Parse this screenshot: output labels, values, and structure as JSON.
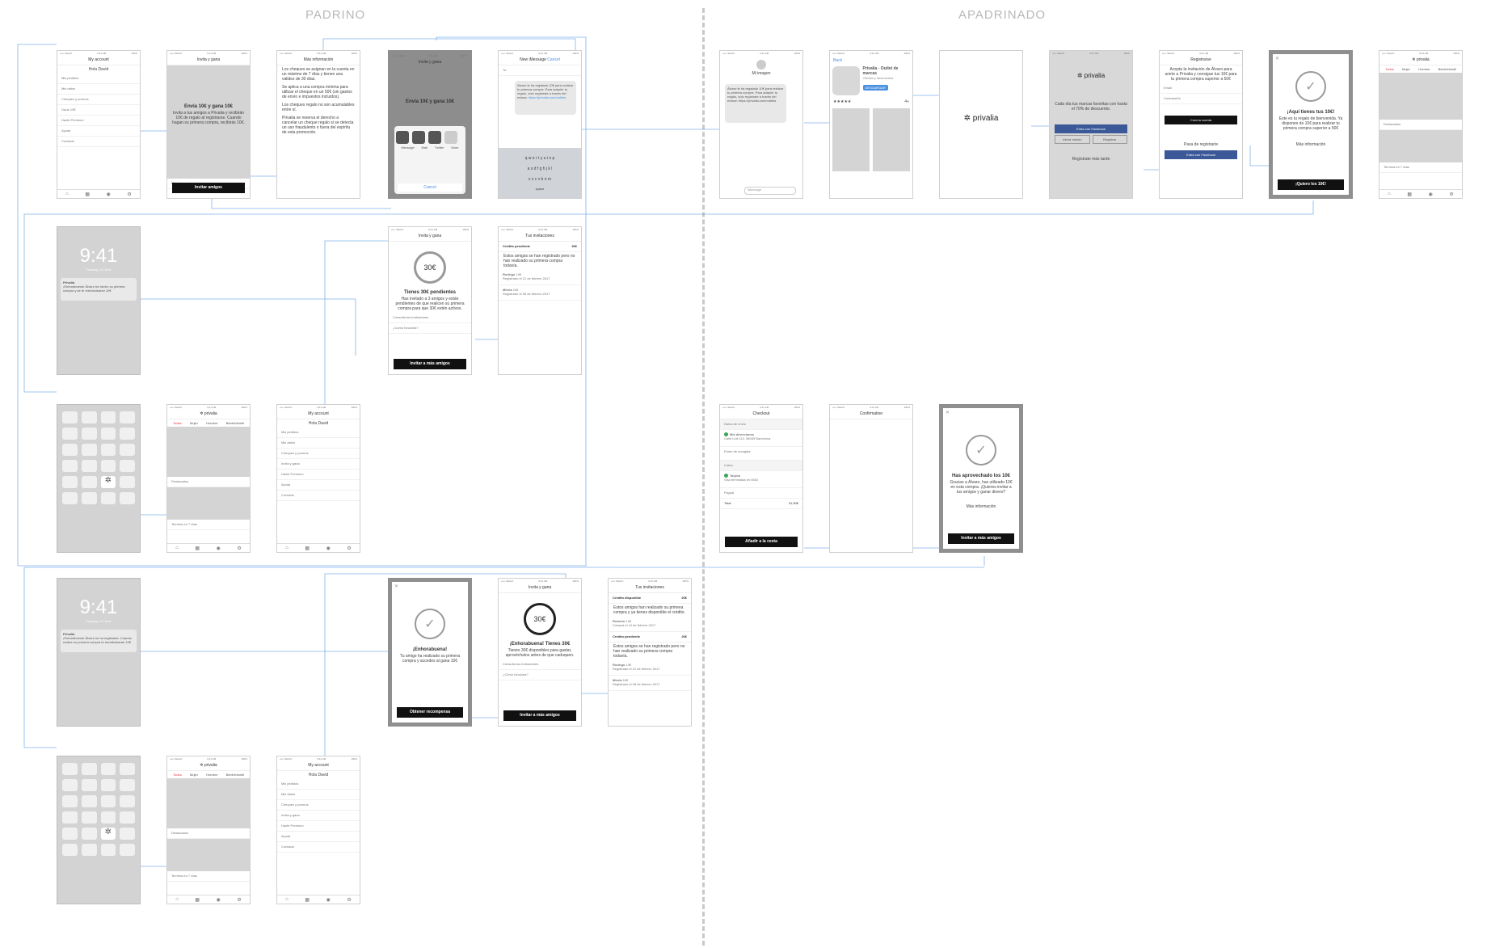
{
  "sections": {
    "padrino": "PADRINO",
    "apadrinado": "APADRINADO"
  },
  "common": {
    "status": "••••• Sketch",
    "status_time": "9:41 AM",
    "status_battery": "100%"
  },
  "screens": {
    "my_account": {
      "title": "My account",
      "greeting": "Hola David",
      "menu": [
        "Mis pedidos",
        "Mis datos",
        "Cheques y promos",
        "Gana 10€",
        "Hazte Premium",
        "Ayuda",
        "Contacto"
      ],
      "menu_row2": [
        "Mis pedidos",
        "Mis datos",
        "Cheques y promos",
        "Invita y gana",
        "Hazte Premium",
        "Ayuda",
        "Contacto"
      ]
    },
    "invite": {
      "title": "Invita y gana",
      "headline": "Envía 10€ y gana 10€",
      "body": "Invita a tus amigos a Privalia y recibirán 10€ de regalo al registrarse. Cuando hagan su primera compra, recibirás 10€.",
      "more_info": "Más información",
      "cta": "Invitar amigos"
    },
    "more_info": {
      "title": "Más información",
      "p1": "Los cheques se asignan en la cuenta en un máximo de 7 días y tienen una validez de 30 días.",
      "p2": "Se aplica a una compra mínima para utilizar el cheque en un 50€ (sin gastos de envío e impuestos incluidos).",
      "p3": "Los cheques regalo no son acumulables entre sí.",
      "p4": "Privalia se reserva el derecho a cancelar un cheque regalo si se detecta un uso fraudulento o fuera del espíritu de esta promoción."
    },
    "share": {
      "title": "Invita y gana",
      "headline": "Envía 10€ y gana 10€",
      "apps": [
        "Message",
        "Mail",
        "Twitter",
        "More"
      ],
      "cancel": "Cancel"
    },
    "message": {
      "title": "New iMessage",
      "cancel": "Cancel",
      "to": "To:",
      "body": "Alvaro te ha regalado 10€ para realizar tu primera compra. Para adquirir tu regalo, sólo regístrate a través del enlace.",
      "link": "https://privalia.com/outlets",
      "keys_row1": "q w e r t y u i o p",
      "keys_row2": "a s d f g h j k l",
      "keys_row3": "z x c v b n m",
      "space": "space"
    },
    "lock1": {
      "time": "9:41",
      "date": "Tuesday, 10 June",
      "app": "Privalia",
      "notif": "¡Enhorabuena! Álvaro ha hecho su primera compra y se te reembolsaran 10€"
    },
    "lock2": {
      "time": "9:41",
      "date": "Tuesday, 10 June",
      "app": "Privalia",
      "notif": "¡Enhorabuena! Álvaro se ha registrado. Cuando realice su primera compra te reembolsaran 10€"
    },
    "status_pending": {
      "title": "Invita y gana",
      "amount": "30€",
      "headline": "Tienes 30€ pendientes",
      "body": "Has invitado a 3 amigos y están pendientes de que realicen su primera compra para que 30€ estén activos.",
      "link1": "Consulta tus invitaciones",
      "link2": "¿Cómo funciona?",
      "cta": "Invitar a más amigos"
    },
    "invitations_pending": {
      "title": "Tus invitaciones",
      "section": "Crédito pendiente",
      "section_amount": "30€",
      "note": "Estos amigos se han registrado pero no han realizado su primera compra todavía.",
      "people": [
        {
          "name": "Rodrigo",
          "date": "Registrado el 21 de febrero 2017",
          "amount": "10€"
        },
        {
          "name": "Mireia",
          "date": "Registrado el 08 de febrero 2017",
          "amount": "10€"
        }
      ]
    },
    "home": {
      "logo": "privalia",
      "tabs": [
        "Todos",
        "Mujer",
        "Hombre",
        "Bebé/Infantil"
      ],
      "promo": "Destacados",
      "footer": "Termina en 7 días"
    },
    "congrats": {
      "title": "¡Enhorabuena!",
      "body": "Tu amigo ha realizado su primera compra y accedes al gana 10€",
      "cta": "Obtener recompensa"
    },
    "status_available": {
      "title": "Invita y gana",
      "amount": "30€",
      "headline": "¡Enhorabuena! Tienes 30€",
      "body": "Tienes 30€ disponibles para gastar, aprovéchalos antes de que caduquen.",
      "link1": "Consulta tus invitaciones",
      "link2": "¿Cómo funciona?",
      "cta": "Invitar a más amigos"
    },
    "invitations_available": {
      "title": "Tus invitaciones",
      "section1": "Crédito disponible",
      "section1_amount": "20€",
      "note1": "Estos amigos han realizado su primera compra y ya tienes disponible el crédito.",
      "person1": {
        "name": "Roberto",
        "date": "Compra el 14 de febrero 2017",
        "amount": "10€"
      },
      "section2": "Crédito pendiente",
      "section2_amount": "20€",
      "note2": "Estos amigos se han registrado pero no han realizado su primera compra todavía.",
      "people2": [
        {
          "name": "Rodrigo",
          "date": "Registrado el 21 de febrero 2017",
          "amount": "10€"
        },
        {
          "name": "Mireia",
          "date": "Registrado el 08 de febrero 2017",
          "amount": "10€"
        }
      ]
    },
    "imessage_recv": {
      "sender": "Mi imagen",
      "bubble": "Álvaro te ha regalado 10€ para realizar tu primera compra. Para adquirir tu regalo, sólo regístrate a través del enlace: https://privalia.com/outlets",
      "input": "iMessage"
    },
    "appstore": {
      "back": "Back",
      "app_name": "Privalia - Outlet de marcas",
      "app_sub": "Ofertas y descuentos",
      "get": "DESCARGAR",
      "rating": "★★★★★",
      "age": "4+"
    },
    "splash": {
      "logo": "privalia"
    },
    "onboarding": {
      "logo": "privalia",
      "body": "Cada día tus marcas favoritas con hasta el 70% de descuento.",
      "facebook": "Entra con Facebook",
      "login": "Iniciar sesión",
      "register": "Registrar",
      "later": "Regístrate más tarde"
    },
    "register": {
      "title": "Registrarse",
      "body": "Acepta la invitación de Álvaro para unirte a Privalia y consigue tus 10€ para tu primera compra superior a 50€",
      "email": "Email",
      "password": "Contraseña",
      "cta": "Crea tu cuenta",
      "or": "Pasa de registrarte",
      "facebook": "Entra con Facebook"
    },
    "gift": {
      "title": "¡Aquí tienes tus 10€!",
      "body": "Este es tu regalo de bienvenida. Ya dispones de 10€ para realizar tu primera compra superior a 50€",
      "more": "Más información",
      "cta": "¡Quiero los 10€!"
    },
    "checkout": {
      "title": "Checkout",
      "section1": "Datos de envío",
      "address_label": "Mis direcciones",
      "address": "Calle Llull 113, 08005 Barcelona",
      "pickup": "Punto de recogida",
      "section2": "Cobro",
      "card": "Tarjeta",
      "card_detail": "Visa terminada en 5602",
      "paypal": "Paypal",
      "total_label": "Total",
      "total": "31,90€",
      "cta": "Añadir a la cesta"
    },
    "confirmation": {
      "title": "Confirmation"
    },
    "used": {
      "title": "Has aprovechado los 10€",
      "body": "Gracias a Álvaro, has utilizado 10€ en esta compra. ¡Quieres invitar a tus amigos y ganar dinero?",
      "more": "Más información",
      "cta": "Invitar a más amigos"
    }
  },
  "colors": {
    "accent": "#4a90e2",
    "brand_red": "#e2343f",
    "facebook": "#3b5998",
    "wire": "#4a90e2"
  }
}
